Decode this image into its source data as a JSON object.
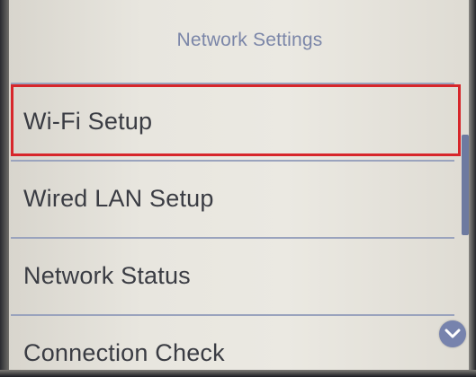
{
  "header": {
    "title": "Network Settings"
  },
  "menu": {
    "items": [
      {
        "label": "Wi-Fi Setup",
        "selected": true
      },
      {
        "label": "Wired LAN Setup",
        "selected": false
      },
      {
        "label": "Network Status",
        "selected": false
      },
      {
        "label": "Connection Check",
        "selected": false
      }
    ]
  },
  "icons": {
    "scroll_down": "chevron-down-icon"
  },
  "colors": {
    "title_text": "#7b86a8",
    "item_text": "#3a3c43",
    "divider": "#9aa3bd",
    "selection_outline": "#d7262b",
    "accent": "#7783ad"
  }
}
